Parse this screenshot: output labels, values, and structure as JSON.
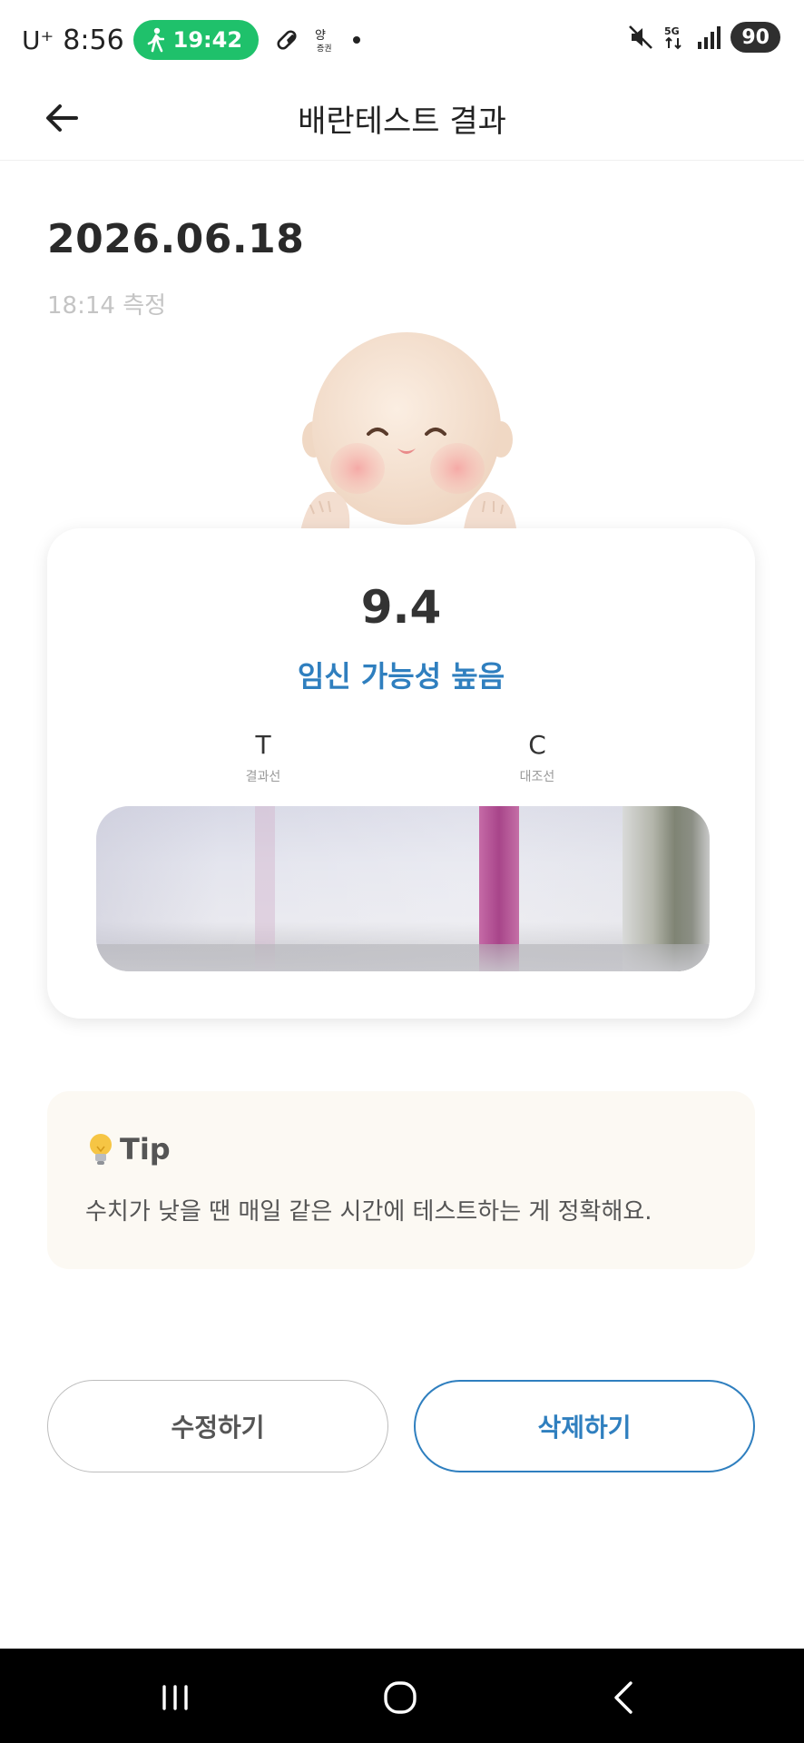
{
  "status_bar": {
    "carrier": "U⁺",
    "time": "8:56",
    "walk_time": "19:42",
    "battery": "90",
    "network": "5G"
  },
  "header": {
    "title": "배란테스트 결과"
  },
  "result": {
    "date": "2026.06.18",
    "measured_time": "18:14 측정",
    "score": "9.4",
    "status": "임신 가능성 높음",
    "t_letter": "T",
    "t_label": "결과선",
    "c_letter": "C",
    "c_label": "대조선"
  },
  "tip": {
    "title": "Tip",
    "text": "수치가 낮을 땐 매일 같은 시간에 테스트하는 게 정확해요."
  },
  "buttons": {
    "edit": "수정하기",
    "delete": "삭제하기"
  },
  "colors": {
    "accent": "#2f7fbf",
    "walk_pill": "#1fc16b",
    "tip_bg": "#fcf9f3"
  }
}
